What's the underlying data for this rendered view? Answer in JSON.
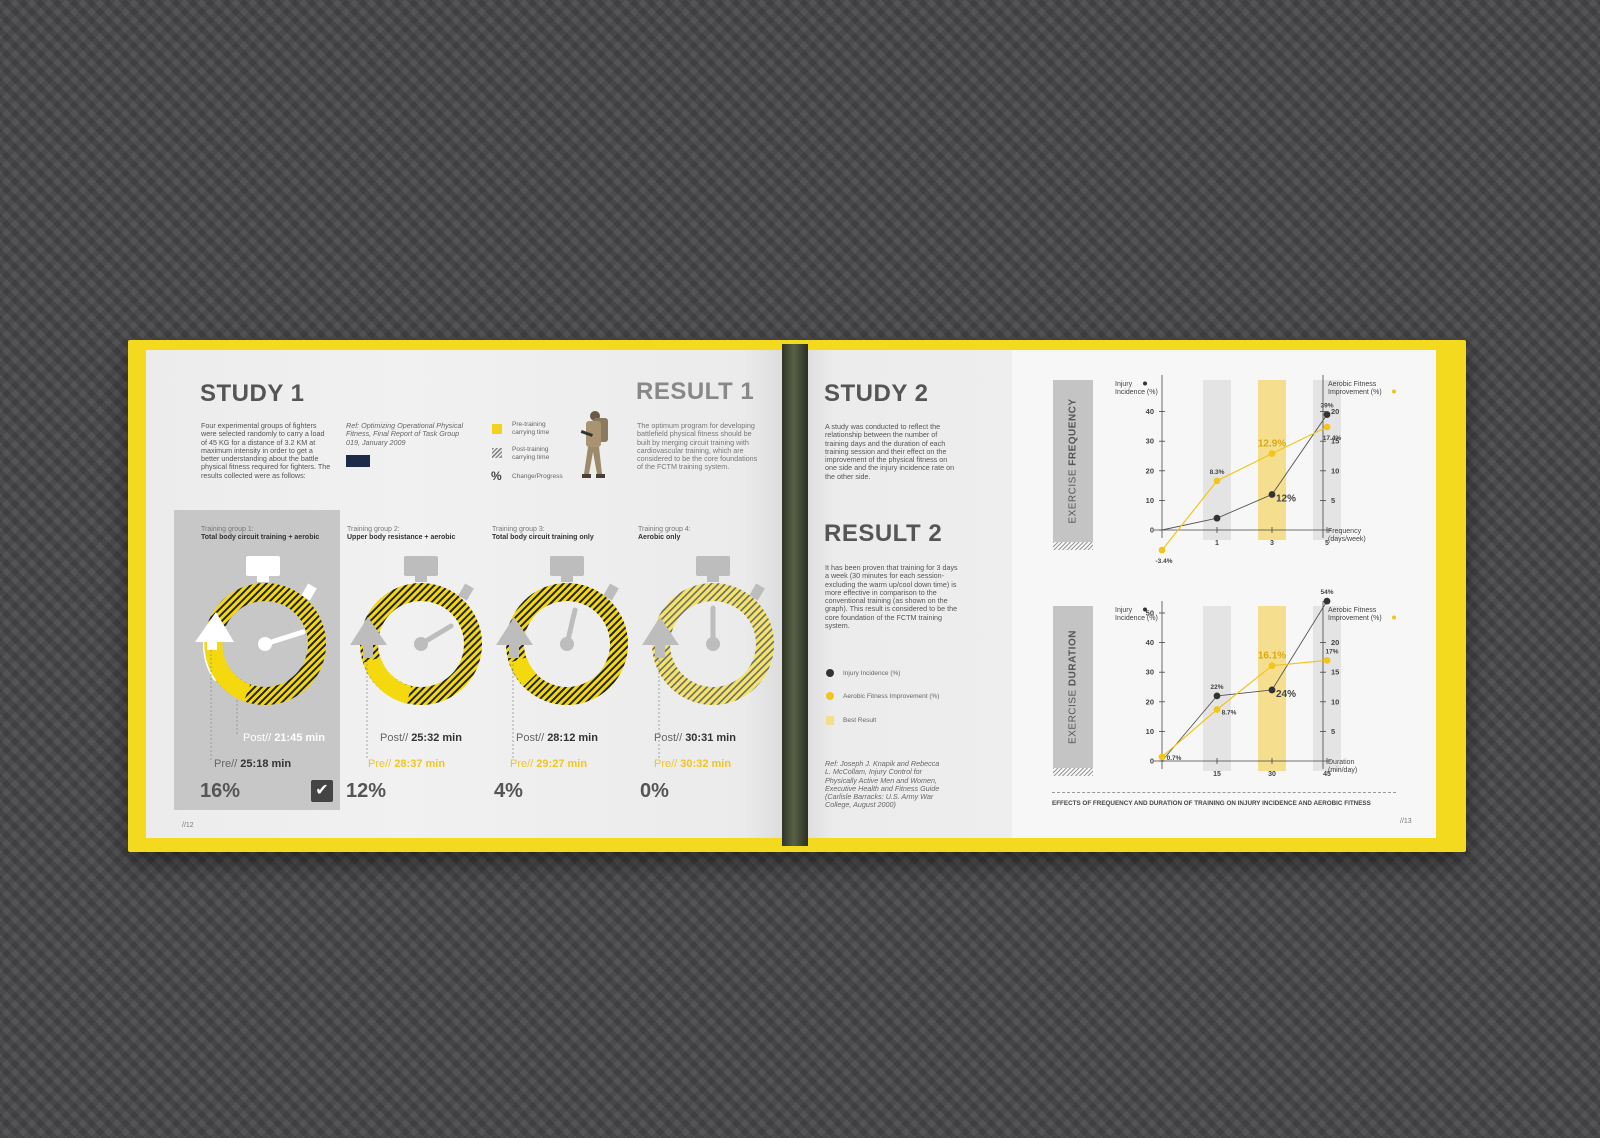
{
  "study1": {
    "title": "STUDY 1",
    "intro": "Four experimental groups of fighters were selected randomly to carry a load of 45 KG for a distance of 3.2 KM at maximum intensity in order to get a better understanding about the battle physical fitness required for fighters. The results collected were as follows:",
    "reference": "Ref: Optimizing Operational Physical Fitness, Final Report of Task Group 019, January 2009"
  },
  "legend1": {
    "pre": "Pre-training carrying time",
    "post": "Post-training carrying time",
    "pct_symbol": "%",
    "change": "Change/Progress"
  },
  "result1": {
    "title": "RESULT 1",
    "text": "The optimum program for developing battlefield physical fitness should be built by merging circuit training with cardiovascular training, which are considered to be the core foundations of the FCTM training system."
  },
  "groups": [
    {
      "label": "Training group 1:",
      "name": "Total body circuit training + aerobic",
      "post_prefix": "Post//",
      "post": "21:45 min",
      "pre_prefix": "Pre//",
      "pre": "25:18 min",
      "change": "16%"
    },
    {
      "label": "Training group 2:",
      "name": "Upper body resistance + aerobic",
      "post_prefix": "Post//",
      "post": "25:32 min",
      "pre_prefix": "Pre//",
      "pre": "28:37 min",
      "change": "12%"
    },
    {
      "label": "Training group 3:",
      "name": "Total body circuit training only",
      "post_prefix": "Post//",
      "post": "28:12 min",
      "pre_prefix": "Pre//",
      "pre": "29:27 min",
      "change": "4%"
    },
    {
      "label": "Training group 4:",
      "name": "Aerobic only",
      "post_prefix": "Post//",
      "post": "30:31 min",
      "pre_prefix": "Pre//",
      "pre": "30:32 min",
      "change": "0%"
    }
  ],
  "page_left_number": "//12",
  "study2": {
    "title": "STUDY 2",
    "text": "A study was conducted to reflect the relationship between the number of training days and the duration of each training session and their effect on the improvement of the physical fitness on one side and the injury incidence rate on the other side."
  },
  "result2": {
    "title": "RESULT 2",
    "text": "It has been proven that training for 3 days a week (30 minutes for each session-excluding the warm up/cool down time) is more effective in comparison to the conventional training (as shown on the graph). This result is considered to be the core foundation of the FCTM training system."
  },
  "legend2": {
    "injury": "Injury Incidence (%)",
    "aerobic": "Aerobic Fitness Improvement (%)",
    "best": "Best Result"
  },
  "reference2": "Ref: Joseph J. Knapik and Rebecca L. McCollam, Injury Control for Physically Active Men and Women, Executive Health and Fitness Guide (Carlisle Barracks: U.S. Army War College, August 2000)",
  "chart_caption": "EFFECTS OF FREQUENCY AND DURATION OF TRAINING ON INJURY INCIDENCE AND AEROBIC FITNESS",
  "page_right_number": "//13",
  "colors": {
    "accent": "#f2c51c",
    "dark": "#333333",
    "grey": "#9a9a9a",
    "cover": "#f3da1e"
  },
  "chart_data": [
    {
      "type": "line",
      "panel_title_light": "EXERCISE",
      "panel_title_bold": "FREQUENCY",
      "ylabel_left": "Injury Incidence (%)",
      "ylabel_right": "Aerobic Fitness Improvement (%)",
      "xlabel": "Frequency (days/week)",
      "x": [
        0,
        1,
        3,
        5
      ],
      "x_ticks": [
        "1",
        "3",
        "5"
      ],
      "y_left_ticks": [
        "0",
        "10",
        "20",
        "30",
        "40"
      ],
      "y_right_ticks": [
        "5",
        "10",
        "15",
        "20"
      ],
      "ylim_left": [
        0,
        40
      ],
      "ylim_right": [
        0,
        20
      ],
      "highlight_x": 3,
      "series": [
        {
          "name": "Injury Incidence (%)",
          "axis": "left",
          "values": [
            0,
            4,
            12,
            39
          ],
          "labels": [
            "",
            "",
            "12%",
            "39%"
          ]
        },
        {
          "name": "Aerobic Fitness Improvement (%)",
          "axis": "right",
          "values": [
            -3.4,
            8.3,
            12.9,
            17.4
          ],
          "labels": [
            "-3.4%",
            "8.3%",
            "12.9%",
            "17.4%"
          ]
        }
      ]
    },
    {
      "type": "line",
      "panel_title_light": "EXERCISE",
      "panel_title_bold": "DURATION",
      "ylabel_left": "Injury Incidence (%)",
      "ylabel_right": "Aerobic Fitness Improvement (%)",
      "xlabel": "Duration (min/day)",
      "x": [
        0,
        15,
        30,
        45
      ],
      "x_ticks": [
        "15",
        "30",
        "45"
      ],
      "y_left_ticks": [
        "0",
        "10",
        "20",
        "30",
        "40",
        "50"
      ],
      "y_right_ticks": [
        "5",
        "10",
        "15",
        "20"
      ],
      "ylim_left": [
        0,
        50
      ],
      "ylim_right": [
        0,
        20
      ],
      "highlight_x": 30,
      "series": [
        {
          "name": "Injury Incidence (%)",
          "axis": "left",
          "values": [
            0,
            22,
            24,
            54
          ],
          "labels": [
            "",
            "22%",
            "24%",
            "54%"
          ]
        },
        {
          "name": "Aerobic Fitness Improvement (%)",
          "axis": "right",
          "values": [
            0.7,
            8.7,
            16.1,
            17
          ],
          "labels": [
            "0.7%",
            "8.7%",
            "16.1%",
            "17%"
          ]
        }
      ]
    }
  ]
}
